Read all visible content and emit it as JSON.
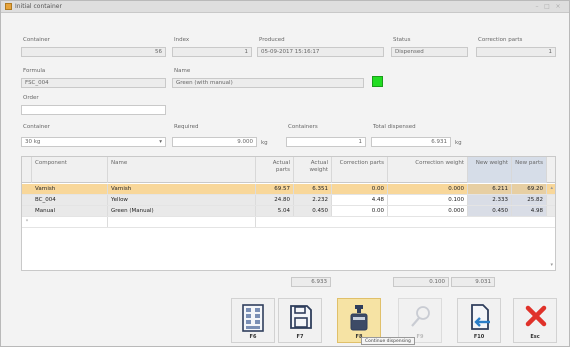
{
  "window": {
    "title": "Initial container"
  },
  "form": {
    "container_label": "Container",
    "container_value": "56",
    "index_label": "Index",
    "index_value": "1",
    "produced_label": "Produced",
    "produced_value": "05-09-2017 15:16:17",
    "status_label": "Status",
    "status_value": "Dispensed",
    "correction_parts_label": "Correction parts",
    "correction_parts_value": "1",
    "formula_label": "Formula",
    "formula_value": "FSC_004",
    "name_label": "Name",
    "name_value": "Green (with manual)",
    "order_label": "Order",
    "order_value": "",
    "container2_label": "Container",
    "container2_value": "30 kg",
    "required_label": "Required",
    "required_value": "9.000",
    "required_unit": "kg",
    "containers_label": "Containers",
    "containers_value": "1",
    "total_dispensed_label": "Total dispensed",
    "total_dispensed_value": "6.931",
    "total_dispensed_unit": "kg"
  },
  "colors": {
    "swatch": "#22dd22",
    "selected_row": "#f8d79a"
  },
  "table": {
    "headers": [
      "Component",
      "Name",
      "Actual parts",
      "Actual weight",
      "Correction parts",
      "Correction weight",
      "New weight",
      "New parts"
    ],
    "rows": [
      [
        "Varnish",
        "Varnish",
        "69.57",
        "6.351",
        "0.00",
        "0.000",
        "6.211",
        "69.20"
      ],
      [
        "BC_004",
        "Yellow",
        "24.80",
        "2.232",
        "4.48",
        "0.100",
        "2.333",
        "25.82"
      ],
      [
        "Manual",
        "Green (Manual)",
        "5.04",
        "0.450",
        "0.00",
        "0.000",
        "0.450",
        "4.98"
      ]
    ]
  },
  "totals": {
    "actual_weight": "6.933",
    "correction_weight": "0.100",
    "new_weight": "9.031"
  },
  "toolbar": {
    "f6_label": "F6",
    "f7_label": "F7",
    "f8_label": "F8",
    "f9_label": "F9",
    "f10_label": "F10",
    "esc_label": "Esc",
    "f8_tooltip": "Continue dispensing"
  }
}
